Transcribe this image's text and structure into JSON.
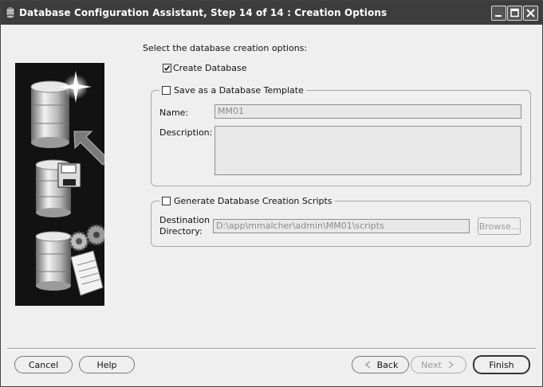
{
  "window": {
    "title": "Database Configuration Assistant, Step 14 of 14 : Creation Options"
  },
  "main": {
    "intro": "Select the database creation options:",
    "create_database": {
      "label": "Create Database",
      "checked": true
    },
    "template_group": {
      "label": "Save as a Database Template",
      "checked": false,
      "name_label": "Name:",
      "name_value": "MM01",
      "description_label": "Description:",
      "description_value": ""
    },
    "scripts_group": {
      "label": "Generate Database Creation Scripts",
      "checked": false,
      "destination_label_line1": "Destination",
      "destination_label_line2": "Directory:",
      "destination_value": "D:\\app\\mmalcher\\admin\\MM01\\scripts",
      "browse_label": "Browse..."
    }
  },
  "footer": {
    "cancel_label": "Cancel",
    "help_label": "Help",
    "back_label": "Back",
    "next_label": "Next",
    "finish_label": "Finish"
  }
}
